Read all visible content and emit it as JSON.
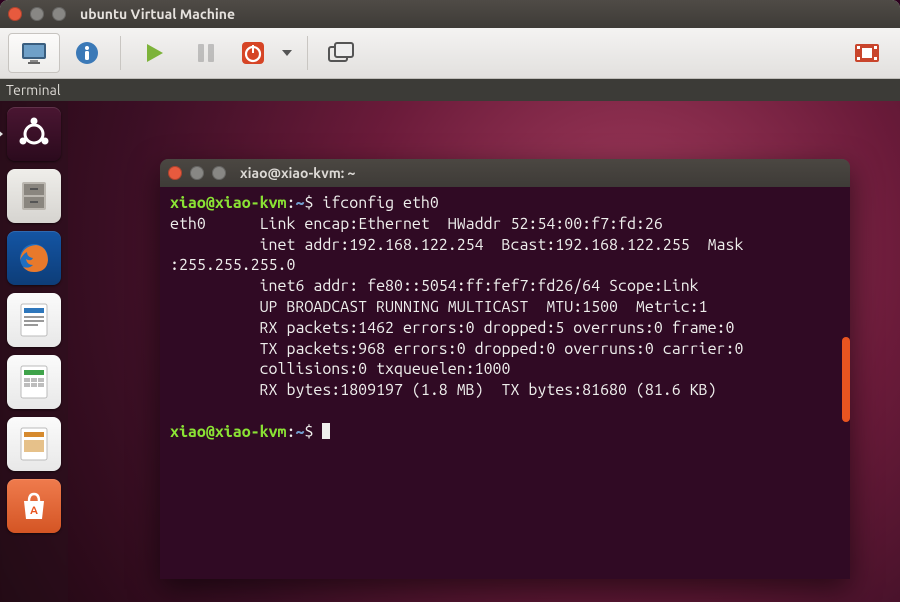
{
  "vm": {
    "title": "ubuntu Virtual Machine",
    "menubar_item": "Terminal"
  },
  "terminal": {
    "title": "xiao@xiao-kvm: ~",
    "prompt_user": "xiao",
    "prompt_host": "xiao-kvm",
    "prompt_path": "~",
    "command": "ifconfig eth0",
    "output_lines": [
      "eth0      Link encap:Ethernet  HWaddr 52:54:00:f7:fd:26",
      "          inet addr:192.168.122.254  Bcast:192.168.122.255  Mask",
      ":255.255.255.0",
      "          inet6 addr: fe80::5054:ff:fef7:fd26/64 Scope:Link",
      "          UP BROADCAST RUNNING MULTICAST  MTU:1500  Metric:1",
      "          RX packets:1462 errors:0 dropped:5 overruns:0 frame:0",
      "          TX packets:968 errors:0 dropped:0 overruns:0 carrier:0",
      "          collisions:0 txqueuelen:1000",
      "          RX bytes:1809197 (1.8 MB)  TX bytes:81680 (81.6 KB)"
    ]
  },
  "launcher": {
    "items": [
      {
        "name": "dash",
        "color": "#2c001e"
      },
      {
        "name": "files",
        "color": "#e7e5e3"
      },
      {
        "name": "firefox",
        "color": "#0f4aa0"
      },
      {
        "name": "writer",
        "color": "#f6f6f6"
      },
      {
        "name": "calc",
        "color": "#f6f6f6"
      },
      {
        "name": "impress",
        "color": "#f6f6f6"
      },
      {
        "name": "software",
        "color": "#e95420"
      }
    ]
  },
  "colors": {
    "ubuntu_orange": "#e95420",
    "term_bg": "#300a24",
    "term_green": "#8ae234",
    "term_blue": "#729fcf"
  }
}
